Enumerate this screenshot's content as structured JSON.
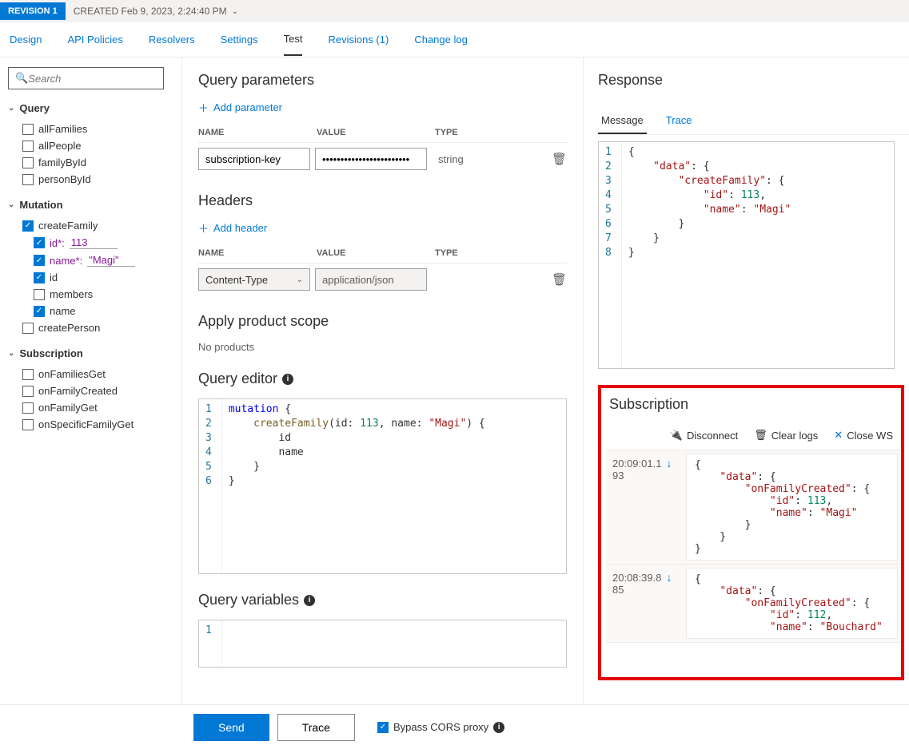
{
  "revision": {
    "badge": "REVISION 1",
    "created": "CREATED Feb 9, 2023, 2:24:40 PM"
  },
  "tabs": [
    "Design",
    "API Policies",
    "Resolvers",
    "Settings",
    "Test",
    "Revisions (1)",
    "Change log"
  ],
  "active_tab": "Test",
  "search": {
    "placeholder": "Search"
  },
  "sidebar": {
    "groups": [
      {
        "label": "Query",
        "items": [
          {
            "label": "allFamilies",
            "checked": false
          },
          {
            "label": "allPeople",
            "checked": false
          },
          {
            "label": "familyById",
            "checked": false
          },
          {
            "label": "personById",
            "checked": false
          }
        ]
      },
      {
        "label": "Mutation",
        "items": [
          {
            "label": "createFamily",
            "checked": true,
            "children": [
              {
                "label": "id*:",
                "value": "113",
                "checked": true,
                "input": true
              },
              {
                "label": "name*:",
                "value": "\"Magi\"",
                "checked": true,
                "input": true
              },
              {
                "label": "id",
                "checked": true
              },
              {
                "label": "members",
                "checked": false
              },
              {
                "label": "name",
                "checked": true
              }
            ]
          },
          {
            "label": "createPerson",
            "checked": false
          }
        ]
      },
      {
        "label": "Subscription",
        "items": [
          {
            "label": "onFamiliesGet",
            "checked": false
          },
          {
            "label": "onFamilyCreated",
            "checked": false
          },
          {
            "label": "onFamilyGet",
            "checked": false
          },
          {
            "label": "onSpecificFamilyGet",
            "checked": false
          }
        ]
      }
    ]
  },
  "center": {
    "query_params": {
      "title": "Query parameters",
      "add": "Add parameter",
      "columns": [
        "NAME",
        "VALUE",
        "TYPE"
      ],
      "rows": [
        {
          "name": "subscription-key",
          "value": "••••••••••••••••••••••••",
          "type": "string"
        }
      ]
    },
    "headers": {
      "title": "Headers",
      "add": "Add header",
      "columns": [
        "NAME",
        "VALUE",
        "TYPE"
      ],
      "rows": [
        {
          "name": "Content-Type",
          "value": "application/json",
          "type": ""
        }
      ]
    },
    "scope": {
      "title": "Apply product scope",
      "none": "No products"
    },
    "editor": {
      "title": "Query editor",
      "lines": [
        "mutation {",
        "    createFamily(id: 113, name: \"Magi\") {",
        "        id",
        "        name",
        "    }",
        "}"
      ]
    },
    "variables": {
      "title": "Query variables"
    }
  },
  "response": {
    "title": "Response",
    "tabs": [
      "Message",
      "Trace"
    ],
    "active": "Message",
    "json_lines": [
      "{",
      "    \"data\": {",
      "        \"createFamily\": {",
      "            \"id\": 113,",
      "            \"name\": \"Magi\"",
      "        }",
      "    }",
      "}"
    ]
  },
  "subscription": {
    "title": "Subscription",
    "actions": {
      "disconnect": "Disconnect",
      "clear": "Clear logs",
      "close": "Close WS"
    },
    "events": [
      {
        "time": "20:09:01.1",
        "time2": "93",
        "body": "{\n    \"data\": {\n        \"onFamilyCreated\": {\n            \"id\": 113,\n            \"name\": \"Magi\"\n        }\n    }\n}"
      },
      {
        "time": "20:08:39.8",
        "time2": "85",
        "body": "{\n    \"data\": {\n        \"onFamilyCreated\": {\n            \"id\": 112,\n            \"name\": \"Bouchard\""
      }
    ]
  },
  "footer": {
    "send": "Send",
    "trace": "Trace",
    "bypass": "Bypass CORS proxy"
  }
}
